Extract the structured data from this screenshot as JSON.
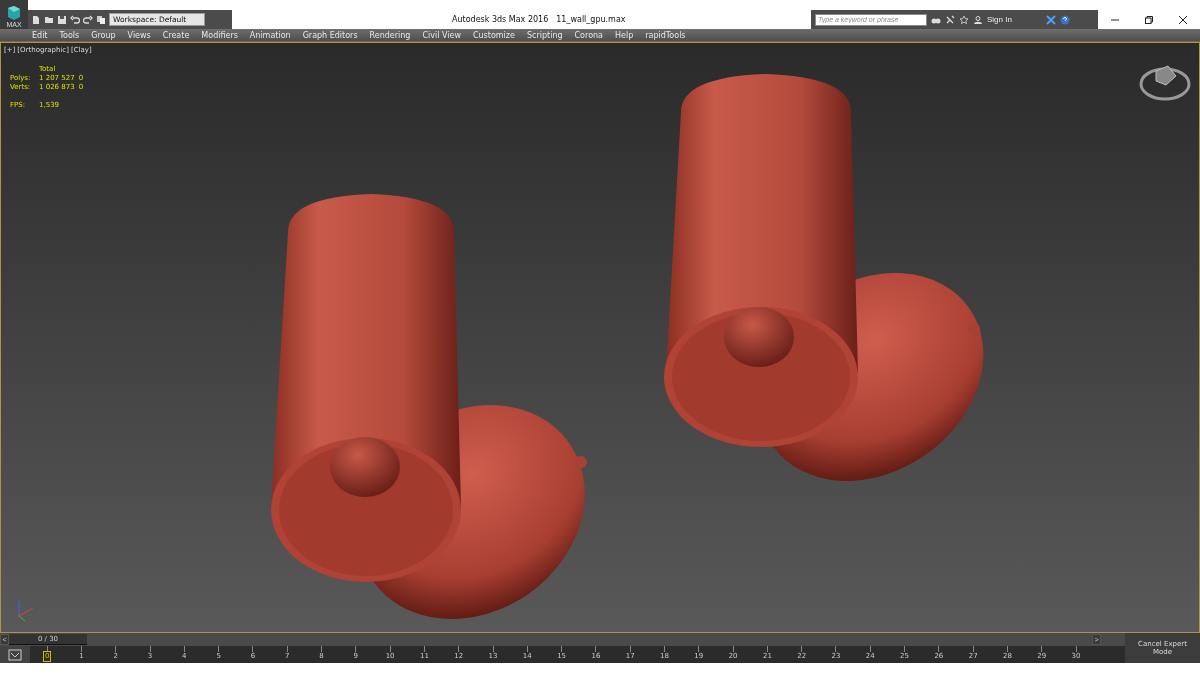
{
  "title_bar": {
    "app_button_label": "MAX",
    "workspace": "Workspace: Default",
    "title": "Autodesk 3ds Max 2016",
    "file": "11_wall_gpu.max",
    "search": {
      "placeholder": "Type a keyword or phrase"
    },
    "sign_in": "Sign In"
  },
  "menu": [
    "Edit",
    "Tools",
    "Group",
    "Views",
    "Create",
    "Modifiers",
    "Animation",
    "Graph Editors",
    "Rendering",
    "Civil View",
    "Customize",
    "Scripting",
    "Corona",
    "Help",
    "rapidTools"
  ],
  "viewport": {
    "labels": [
      "[+]",
      "[Orthographic]",
      "[Clay]"
    ],
    "stats": {
      "heading": "Total",
      "rows": [
        {
          "label": "Polys:",
          "value": "1 207 527",
          "extra": "0"
        },
        {
          "label": "Verts:",
          "value": "1 026 873",
          "extra": "0"
        }
      ],
      "fps_label": "FPS:",
      "fps_value": "1,539"
    }
  },
  "time_slider": {
    "prev": "<",
    "position": "0 / 30",
    "next": ">",
    "level": 0
  },
  "track": {
    "ticks": [
      {
        "label": "0",
        "selected": true
      },
      {
        "label": "1",
        "selected": false
      },
      {
        "label": "2",
        "selected": false
      },
      {
        "label": "3",
        "selected": false
      },
      {
        "label": "4",
        "selected": false
      },
      {
        "label": "5",
        "selected": false
      },
      {
        "label": "6",
        "selected": false
      },
      {
        "label": "7",
        "selected": false
      },
      {
        "label": "8",
        "selected": false
      },
      {
        "label": "9",
        "selected": false
      },
      {
        "label": "10",
        "selected": false
      },
      {
        "label": "11",
        "selected": false
      },
      {
        "label": "12",
        "selected": false
      },
      {
        "label": "13",
        "selected": false
      },
      {
        "label": "14",
        "selected": false
      },
      {
        "label": "15",
        "selected": false
      },
      {
        "label": "16",
        "selected": false
      },
      {
        "label": "17",
        "selected": false
      },
      {
        "label": "18",
        "selected": false
      },
      {
        "label": "19",
        "selected": false
      },
      {
        "label": "20",
        "selected": false
      },
      {
        "label": "21",
        "selected": false
      },
      {
        "label": "22",
        "selected": false
      },
      {
        "label": "23",
        "selected": false
      },
      {
        "label": "24",
        "selected": false
      },
      {
        "label": "25",
        "selected": false
      },
      {
        "label": "26",
        "selected": false
      },
      {
        "label": "27",
        "selected": false
      },
      {
        "label": "28",
        "selected": false
      },
      {
        "label": "29",
        "selected": false
      },
      {
        "label": "30",
        "selected": false
      }
    ]
  },
  "status": {
    "expert_button": "Cancel Expert Mode"
  }
}
